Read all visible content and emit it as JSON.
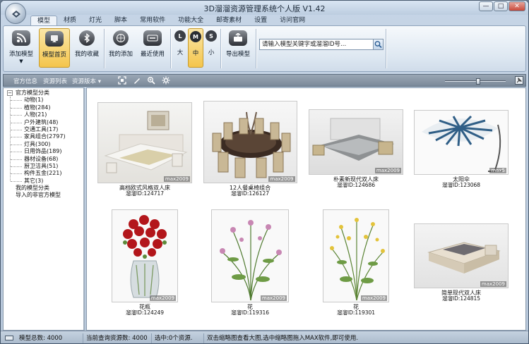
{
  "window": {
    "title": "3D溜溜资源管理系统个人版 V1.42",
    "controls": {
      "minimize": "—",
      "maximize": "□",
      "close": "✕"
    }
  },
  "tabs": [
    "模型",
    "材质",
    "灯光",
    "脚本",
    "常用软件",
    "功能大全",
    "邮寄素材",
    "设置",
    "访问官网"
  ],
  "ribbon": {
    "add_model": "添加模型",
    "model_home": "模型首页",
    "my_favorites": "我的收藏",
    "my_added": "我的添加",
    "recent_used": "最近使用",
    "size_large": "大",
    "size_medium": "中",
    "size_small": "小",
    "size_large_icon": "L",
    "size_medium_icon": "M",
    "size_small_icon": "S",
    "export_model": "导出模型",
    "search_placeholder": "请输入模型关键字或溜溜ID号..."
  },
  "subbar": {
    "official_info": "官方信息",
    "resource_list": "资源列表",
    "resource_version": "资源版本 ▾",
    "zoom_level": 0.55
  },
  "tree": {
    "official_root": "官方模型分类",
    "children": [
      "动物(1)",
      "植物(284)",
      "人物(21)",
      "户外建筑(48)",
      "交通工具(17)",
      "家具组合(2797)",
      "灯具(300)",
      "日用饰品(189)",
      "器材设备(68)",
      "厨卫洁具(51)",
      "构件五金(221)",
      "其它(3)"
    ],
    "my_models": "我的模型分类",
    "imported": "导入的非官方模型"
  },
  "models": [
    {
      "name": "高档欧式风格双人床",
      "id": "溜溜ID:124717",
      "watermark": "max2009"
    },
    {
      "name": "12人餐桌椅组合",
      "id": "溜溜ID:126127",
      "watermark": "max2009"
    },
    {
      "name": "朴素新现代双人床",
      "id": "溜溜ID:124686",
      "watermark": "max2009"
    },
    {
      "name": "太阳伞",
      "id": "溜溜ID:123068",
      "watermark": "max5"
    },
    {
      "name": "花瓶",
      "id": "溜溜ID:124249",
      "watermark": "max2009"
    },
    {
      "name": "花",
      "id": "溜溜ID:119316",
      "watermark": "max2009"
    },
    {
      "name": "花",
      "id": "溜溜ID:119301",
      "watermark": "max2009"
    },
    {
      "name": "简单现代双人床",
      "id": "溜溜ID:124815",
      "watermark": "max2009"
    }
  ],
  "status": {
    "total_models": "模型总数: 4000",
    "current_query": "当前查询资源数: 4000",
    "selected": "选中:0个资源.",
    "hint": "双击缩略图查看大图,选中缩略图拖入MAX软件,即可使用."
  },
  "colors": {
    "active_button": "#f4c54c",
    "ribbon_bg": "#dde7f1",
    "frame": "#b7c7da"
  }
}
